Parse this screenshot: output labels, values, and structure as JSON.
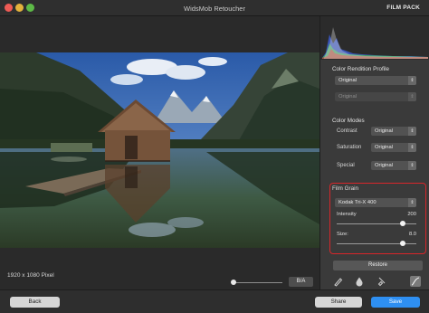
{
  "window": {
    "title": "WidsMob Retoucher",
    "mode_label": "FILM PACK"
  },
  "canvas": {
    "dimensions_text": "1920 x 1080 Pixel",
    "compare_button": "B/A"
  },
  "panel": {
    "color_rendition": {
      "title": "Color Rendition Profile",
      "primary_value": "Original",
      "secondary_value": "Original"
    },
    "color_modes": {
      "title": "Color Modes",
      "rows": [
        {
          "label": "Contrast",
          "value": "Original"
        },
        {
          "label": "Saturation",
          "value": "Original"
        },
        {
          "label": "Special",
          "value": "Original"
        }
      ]
    },
    "film_grain": {
      "title": "Film Grain",
      "film_value": "Kodak Tri-X 400",
      "intensity_label": "Intensity",
      "intensity_value": "200",
      "intensity_level": 0.83,
      "size_label": "Size:",
      "size_value": "8.0",
      "size_level": 0.83
    },
    "restore_button": "Restore",
    "tools": [
      "brush-icon",
      "color-drop-icon",
      "clean-brush-icon",
      "film-curve-icon"
    ]
  },
  "footer": {
    "back": "Back",
    "share": "Share",
    "save": "Save"
  },
  "colors": {
    "accent": "#2e8ff2",
    "highlight_border": "#d8262a"
  }
}
